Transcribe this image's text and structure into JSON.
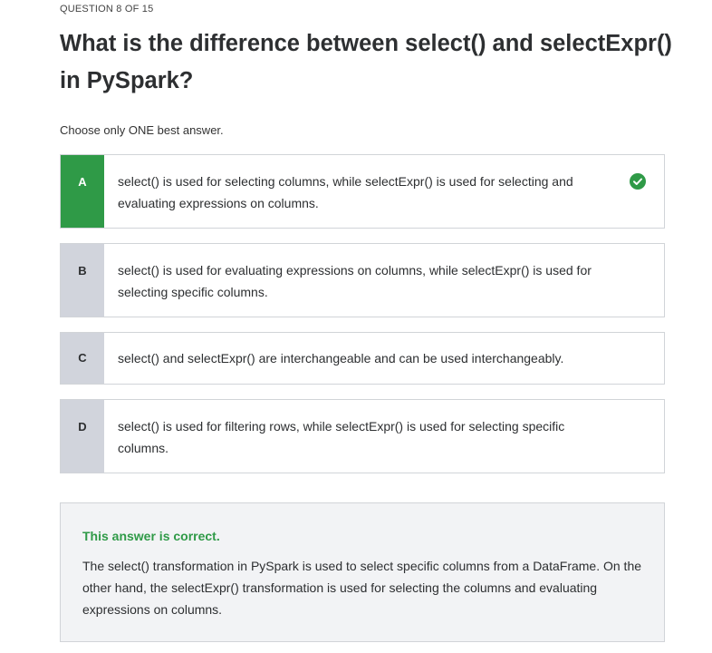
{
  "question": {
    "counter": "QUESTION 8 OF 15",
    "title": "What is the difference between select() and selectExpr() in PySpark?",
    "instruction": "Choose only ONE best answer."
  },
  "options": [
    {
      "letter": "A",
      "text": "select() is used for selecting columns, while selectExpr() is used for selecting and evaluating expressions on columns.",
      "correct": true
    },
    {
      "letter": "B",
      "text": "select() is used for evaluating expressions on columns, while selectExpr() is used for selecting specific columns."
    },
    {
      "letter": "C",
      "text": "select() and selectExpr() are interchangeable and can be used interchangeably."
    },
    {
      "letter": "D",
      "text": "select() is used for filtering rows, while selectExpr() is used for selecting specific columns."
    }
  ],
  "explanation": {
    "verdict": "This answer is correct.",
    "body": "The select() transformation in PySpark is used to select specific columns from a DataFrame. On the other hand, the selectExpr() transformation is used for selecting the columns and evaluating expressions on columns."
  },
  "colors": {
    "correct_green": "#2f9a47",
    "letter_gray": "#d1d4dc",
    "border": "#d1d4d8",
    "explanation_bg": "#f2f3f5"
  },
  "icons": {
    "correct_indicator": "check-circle-icon"
  }
}
